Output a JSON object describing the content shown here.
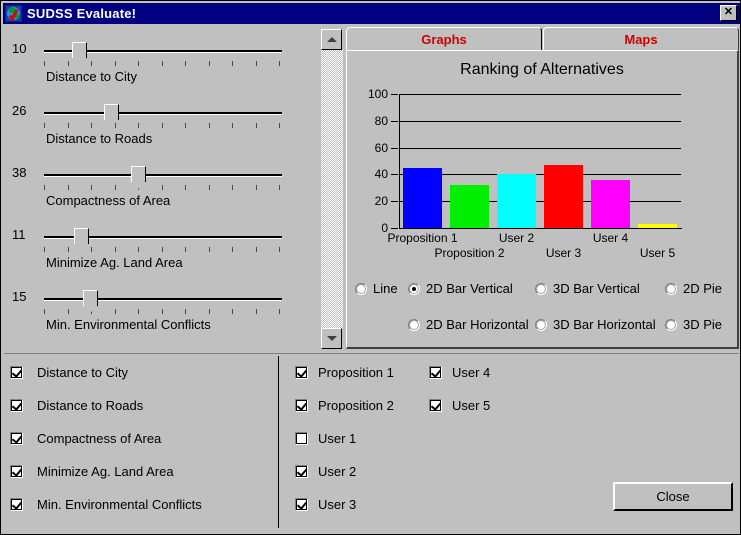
{
  "window": {
    "title": "SUDSS Evaluate!",
    "icon": "globe-check-icon",
    "close_label": "✕",
    "titlebar_color": "#000080",
    "face_color": "#c0c0c0"
  },
  "sliders": [
    {
      "value": "10",
      "label": "Distance to City",
      "percent": 12
    },
    {
      "value": "26",
      "label": "Distance to Roads",
      "percent": 26
    },
    {
      "value": "38",
      "label": "Compactness of Area",
      "percent": 38
    },
    {
      "value": "11",
      "label": "Minimize Ag. Land Area",
      "percent": 13
    },
    {
      "value": "15",
      "label": "Min. Environmental Conflicts",
      "percent": 17
    }
  ],
  "scrollbar": {
    "up_arrow": "scroll-up-arrow-icon",
    "down_arrow": "scroll-down-arrow-icon"
  },
  "tabs": [
    {
      "label": "Graphs",
      "active": true
    },
    {
      "label": "Maps",
      "active": false
    }
  ],
  "chart_data": {
    "type": "bar",
    "title": "Ranking of Alternatives",
    "xlabel": "",
    "ylabel": "",
    "ylim": [
      0,
      100
    ],
    "yticks": [
      0,
      20,
      40,
      60,
      80,
      100
    ],
    "ytick_labels": [
      "0",
      "20",
      "40",
      "60",
      "80",
      "100"
    ],
    "grid": true,
    "legend": "none",
    "categories": [
      "Proposition 1",
      "Proposition 2",
      "User 2",
      "User 3",
      "User 4",
      "User 5"
    ],
    "values": [
      45,
      32,
      40,
      47,
      36,
      3
    ],
    "colors": [
      "#0000ff",
      "#00ee00",
      "#00ffff",
      "#ff0000",
      "#ff00ff",
      "#ffff00"
    ]
  },
  "chart_type_options": [
    {
      "label": "Line",
      "selected": false
    },
    {
      "label": "2D Bar Vertical",
      "selected": true
    },
    {
      "label": "3D Bar Vertical",
      "selected": false
    },
    {
      "label": "2D Pie",
      "selected": false
    },
    {
      "label": "2D Bar Horizontal",
      "selected": false
    },
    {
      "label": "3D Bar Horizontal",
      "selected": false
    },
    {
      "label": "3D Pie",
      "selected": false
    }
  ],
  "criteria_checkboxes": [
    {
      "label": "Distance to City",
      "checked": true
    },
    {
      "label": "Distance to Roads",
      "checked": true
    },
    {
      "label": "Compactness of Area",
      "checked": true
    },
    {
      "label": "Minimize Ag. Land Area",
      "checked": true
    },
    {
      "label": "Min. Environmental Conflicts",
      "checked": true
    }
  ],
  "alternatives_checkboxes_col1": [
    {
      "label": "Proposition 1",
      "checked": true
    },
    {
      "label": "Proposition 2",
      "checked": true
    },
    {
      "label": "User 1",
      "checked": false
    },
    {
      "label": "User 2",
      "checked": true
    },
    {
      "label": "User 3",
      "checked": true
    }
  ],
  "alternatives_checkboxes_col2": [
    {
      "label": "User 4",
      "checked": true
    },
    {
      "label": "User 5",
      "checked": true
    }
  ],
  "buttons": {
    "close": "Close"
  }
}
